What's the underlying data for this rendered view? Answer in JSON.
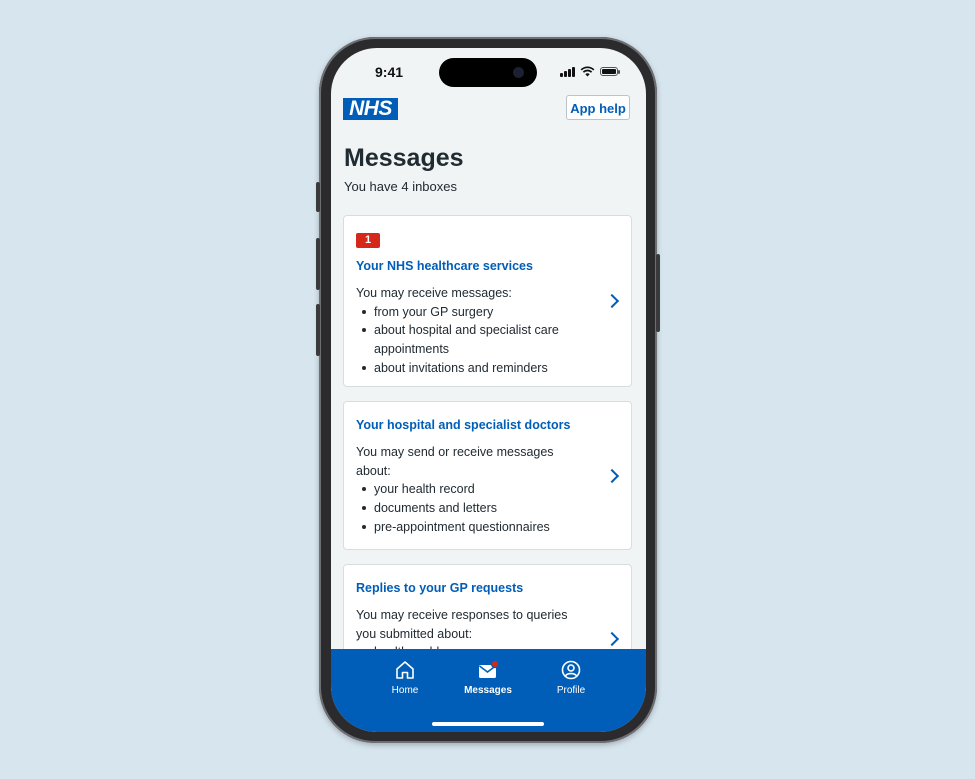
{
  "status_bar": {
    "time": "9:41"
  },
  "header": {
    "logo_text": "NHS",
    "app_help_label": "App help"
  },
  "page": {
    "title": "Messages",
    "subtitle": "You have 4 inboxes"
  },
  "cards": [
    {
      "badge": "1",
      "title": "Your NHS healthcare services",
      "intro": "You may receive messages:",
      "items": [
        "from your GP surgery",
        "about hospital and specialist care appointments",
        "about invitations and reminders"
      ]
    },
    {
      "title": "Your hospital and specialist doctors",
      "intro": "You may send or receive messages about:",
      "items": [
        "your health record",
        "documents and letters",
        "pre-appointment questionnaires"
      ]
    },
    {
      "title": "Replies to your GP requests",
      "intro": "You may receive responses to queries you submitted about:",
      "items": [
        "health problems"
      ]
    }
  ],
  "bottom_nav": {
    "items": [
      {
        "label": "Home",
        "icon": "home-icon"
      },
      {
        "label": "Messages",
        "icon": "messages-icon",
        "active": true
      },
      {
        "label": "Profile",
        "icon": "profile-icon"
      }
    ]
  },
  "colors": {
    "nhs_blue": "#005eb8",
    "badge_red": "#d5281b",
    "page_bg": "#f0f4f5",
    "backdrop": "#d7e5ef"
  }
}
